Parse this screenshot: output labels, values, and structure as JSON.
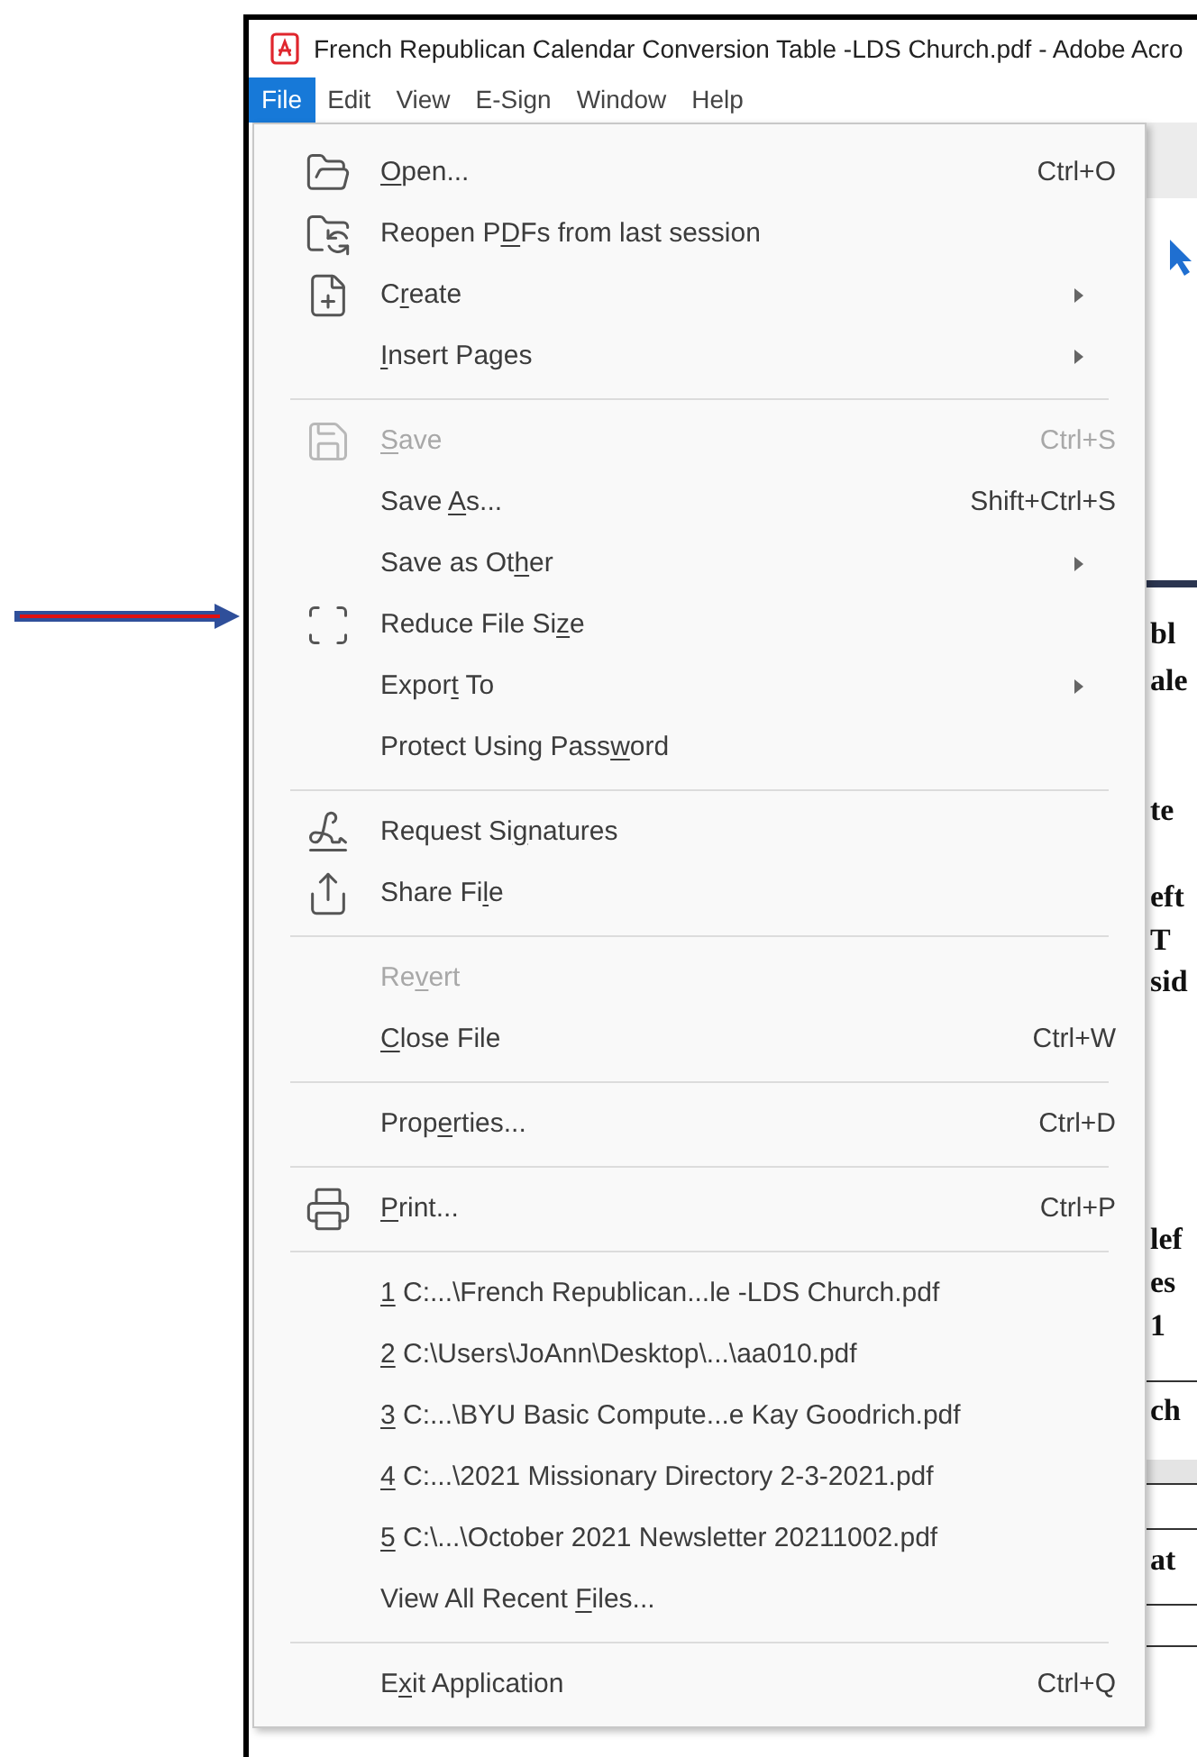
{
  "window": {
    "title": "French Republican Calendar Conversion Table -LDS Church.pdf - Adobe Acro"
  },
  "menubar": [
    {
      "label": "File",
      "selected": true
    },
    {
      "label": "Edit",
      "selected": false
    },
    {
      "label": "View",
      "selected": false
    },
    {
      "label": "E-Sign",
      "selected": false
    },
    {
      "label": "Window",
      "selected": false
    },
    {
      "label": "Help",
      "selected": false
    }
  ],
  "file_menu": [
    {
      "kind": "item",
      "key": "O",
      "post": "pen...",
      "shortcut": "Ctrl+O",
      "submenu": false,
      "disabled": false
    },
    {
      "kind": "item",
      "pre": "Reopen P",
      "key": "D",
      "post": "Fs from last session",
      "submenu": false,
      "disabled": false
    },
    {
      "kind": "item",
      "pre": "C",
      "key": "r",
      "post": "eate",
      "submenu": true,
      "disabled": false
    },
    {
      "kind": "item",
      "key": "I",
      "post": "nsert Pages",
      "submenu": true,
      "disabled": false
    },
    {
      "kind": "separator"
    },
    {
      "kind": "item",
      "key": "S",
      "post": "ave",
      "shortcut": "Ctrl+S",
      "submenu": false,
      "disabled": true
    },
    {
      "kind": "item",
      "pre": "Save ",
      "key": "A",
      "post": "s...",
      "shortcut": "Shift+Ctrl+S",
      "submenu": false,
      "disabled": false
    },
    {
      "kind": "item",
      "pre": "Save as Ot",
      "key": "h",
      "post": "er",
      "submenu": true,
      "disabled": false
    },
    {
      "kind": "item",
      "pre": "Reduce File Si",
      "key": "z",
      "post": "e",
      "submenu": false,
      "disabled": false
    },
    {
      "kind": "item",
      "pre": "Expor",
      "key": "t",
      "post": " To",
      "submenu": true,
      "disabled": false
    },
    {
      "kind": "item",
      "pre": "Protect Using Pass",
      "key": "w",
      "post": "ord",
      "submenu": false,
      "disabled": false
    },
    {
      "kind": "separator"
    },
    {
      "kind": "item",
      "pre": "Request Si",
      "key": "g",
      "post": "natures",
      "submenu": false,
      "disabled": false
    },
    {
      "kind": "item",
      "pre": "Share Fi",
      "key": "l",
      "post": "e",
      "submenu": false,
      "disabled": false
    },
    {
      "kind": "separator"
    },
    {
      "kind": "item",
      "pre": "Re",
      "key": "v",
      "post": "ert",
      "submenu": false,
      "disabled": true
    },
    {
      "kind": "item",
      "key": "C",
      "post": "lose File",
      "shortcut": "Ctrl+W",
      "submenu": false,
      "disabled": false
    },
    {
      "kind": "separator"
    },
    {
      "kind": "item",
      "pre": "Prop",
      "key": "e",
      "post": "rties...",
      "shortcut": "Ctrl+D",
      "submenu": false,
      "disabled": false
    },
    {
      "kind": "separator"
    },
    {
      "kind": "item",
      "key": "P",
      "post": "rint...",
      "shortcut": "Ctrl+P",
      "submenu": false,
      "disabled": false
    },
    {
      "kind": "separator"
    },
    {
      "kind": "recent",
      "key": "1",
      "post": " C:...\\French Republican...le -LDS Church.pdf",
      "submenu": false,
      "disabled": false
    },
    {
      "kind": "recent",
      "key": "2",
      "post": " C:\\Users\\JoAnn\\Desktop\\...\\aa010.pdf",
      "submenu": false,
      "disabled": false
    },
    {
      "kind": "recent",
      "key": "3",
      "post": " C:...\\BYU Basic Compute...e Kay Goodrich.pdf",
      "submenu": false,
      "disabled": false
    },
    {
      "kind": "recent",
      "key": "4",
      "post": " C:...\\2021 Missionary Directory 2-3-2021.pdf",
      "submenu": false,
      "disabled": false
    },
    {
      "kind": "recent",
      "key": "5",
      "post": " C:\\...\\October 2021 Newsletter 20211002.pdf",
      "submenu": false,
      "disabled": false
    },
    {
      "kind": "item",
      "pre": "View All Recent ",
      "key": "F",
      "post": "iles...",
      "submenu": false,
      "disabled": false
    },
    {
      "kind": "separator"
    },
    {
      "kind": "item",
      "pre": "E",
      "key": "x",
      "post": "it Application",
      "shortcut": "Ctrl+Q",
      "submenu": false,
      "disabled": false
    }
  ],
  "document_fragments": [
    {
      "text": "bl"
    },
    {
      "text": "ale"
    },
    {
      "text": "te"
    },
    {
      "text": "eft"
    },
    {
      "text": "T"
    },
    {
      "text": "sid"
    },
    {
      "text": "lef"
    },
    {
      "text": "es"
    },
    {
      "text": "1"
    },
    {
      "text": "ch"
    },
    {
      "text": "at"
    }
  ]
}
